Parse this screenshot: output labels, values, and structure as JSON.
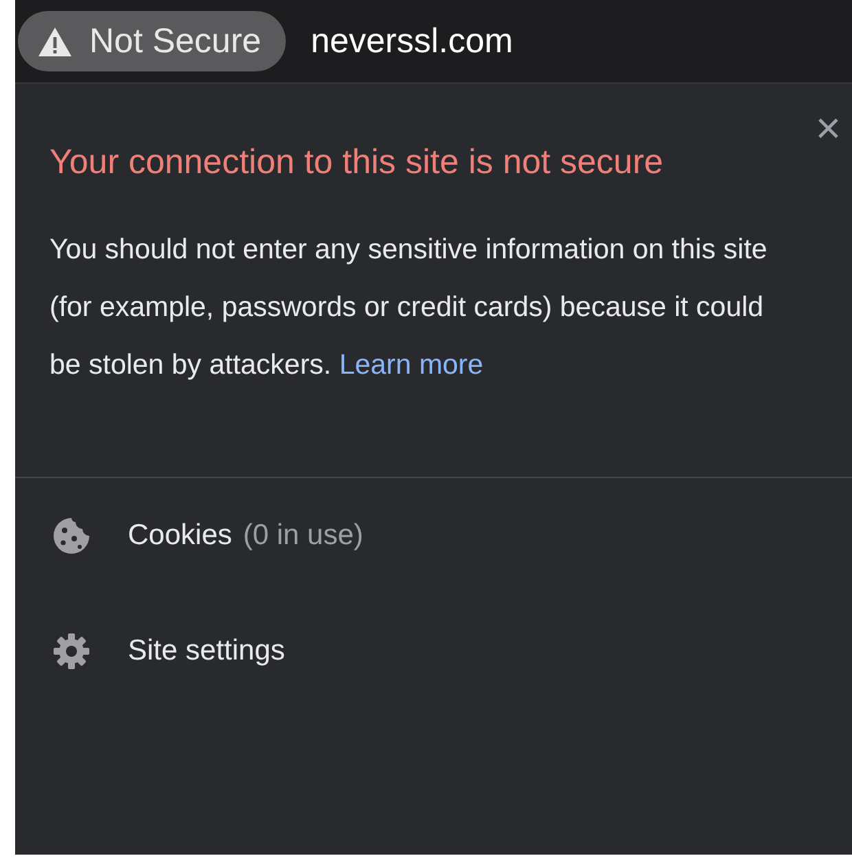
{
  "address_bar": {
    "security_chip": "Not Secure",
    "url": "neverssl.com"
  },
  "popup": {
    "close": "×",
    "title": "Your connection to this site is not secure",
    "message": "You should not enter any sensitive information on this site (for example, passwords or credit cards) because it could be stolen by attackers.",
    "link": "Learn more",
    "items": [
      {
        "kind": "cookies",
        "label": "Cookies",
        "note": "(0 in use)"
      },
      {
        "kind": "settings",
        "label": "Site settings"
      }
    ]
  }
}
